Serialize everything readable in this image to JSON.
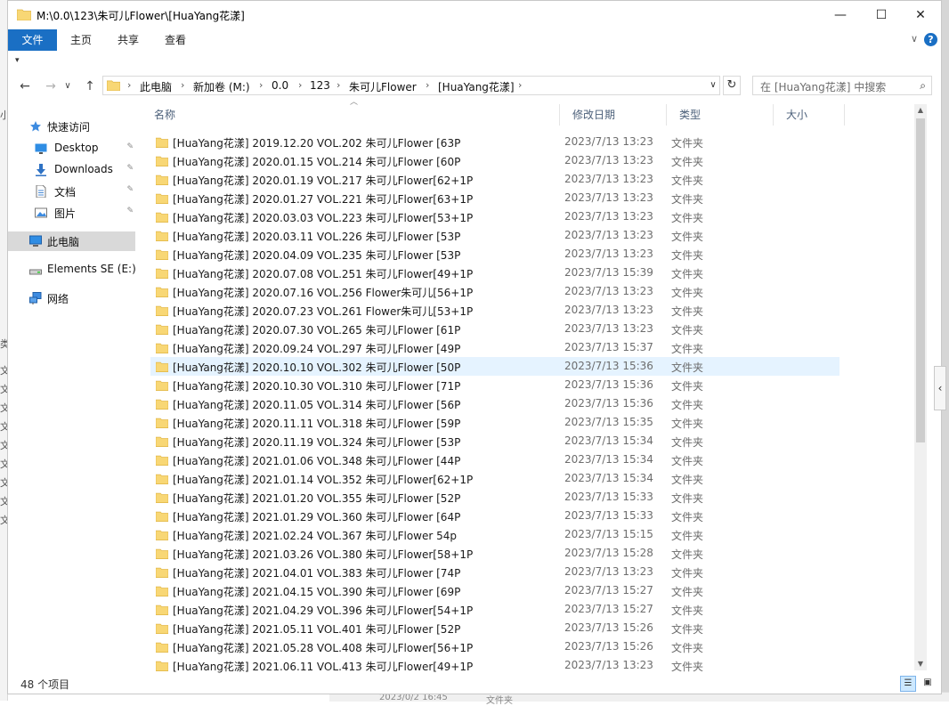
{
  "window": {
    "title": "M:\\0.0\\123\\朱可儿Flower\\[HuaYang花漾]",
    "minimize_glyph": "—",
    "maximize_glyph": "☐",
    "close_glyph": "✕"
  },
  "ribbon": {
    "tabs": [
      "文件",
      "主页",
      "共享",
      "查看"
    ],
    "expand_glyph": "∨",
    "help_glyph": "?"
  },
  "quick_access_glyph": "▾",
  "nav_buttons": {
    "back": "←",
    "forward": "→",
    "recent": "∨",
    "up": "↑"
  },
  "address": {
    "crumbs": [
      "此电脑",
      "新加卷 (M:)",
      "0.0",
      "123",
      "朱可儿Flower",
      "[HuaYang花漾]"
    ],
    "separator": "›",
    "dropdown_glyph": "∨",
    "refresh_glyph": "↻"
  },
  "search": {
    "placeholder": "在 [HuaYang花漾] 中搜索",
    "icon_glyph": "⌕"
  },
  "nav_pane": {
    "items": [
      {
        "label": "快速访问",
        "icon": "star-icon",
        "pinned": false
      },
      {
        "label": "Desktop",
        "icon": "desktop-icon",
        "pinned": true
      },
      {
        "label": "Downloads",
        "icon": "download-icon",
        "pinned": true
      },
      {
        "label": "文档",
        "icon": "document-icon",
        "pinned": true
      },
      {
        "label": "图片",
        "icon": "pictures-icon",
        "pinned": true
      },
      {
        "label": "此电脑",
        "icon": "computer-icon",
        "pinned": false
      },
      {
        "label": "Elements SE (E:)",
        "icon": "drive-icon",
        "pinned": false
      },
      {
        "label": "网络",
        "icon": "network-icon",
        "pinned": false
      }
    ],
    "pin_glyph": "✎"
  },
  "columns": [
    "名称",
    "修改日期",
    "类型",
    "大小"
  ],
  "sort_glyph": "︿",
  "files": [
    {
      "name": "[HuaYang花漾] 2019.12.20 VOL.202 朱可儿Flower [63P",
      "date": "2023/7/13 13:23",
      "type": "文件夹"
    },
    {
      "name": "[HuaYang花漾] 2020.01.15 VOL.214 朱可儿Flower [60P",
      "date": "2023/7/13 13:23",
      "type": "文件夹"
    },
    {
      "name": "[HuaYang花漾] 2020.01.19 VOL.217 朱可儿Flower[62+1P",
      "date": "2023/7/13 13:23",
      "type": "文件夹"
    },
    {
      "name": "[HuaYang花漾] 2020.01.27 VOL.221 朱可儿Flower[63+1P",
      "date": "2023/7/13 13:23",
      "type": "文件夹"
    },
    {
      "name": "[HuaYang花漾] 2020.03.03 VOL.223 朱可儿Flower[53+1P",
      "date": "2023/7/13 13:23",
      "type": "文件夹"
    },
    {
      "name": "[HuaYang花漾] 2020.03.11 VOL.226 朱可儿Flower [53P",
      "date": "2023/7/13 13:23",
      "type": "文件夹"
    },
    {
      "name": "[HuaYang花漾] 2020.04.09 VOL.235 朱可儿Flower [53P",
      "date": "2023/7/13 13:23",
      "type": "文件夹"
    },
    {
      "name": "[HuaYang花漾] 2020.07.08 VOL.251 朱可儿Flower[49+1P",
      "date": "2023/7/13 15:39",
      "type": "文件夹"
    },
    {
      "name": "[HuaYang花漾] 2020.07.16 VOL.256 Flower朱可儿[56+1P",
      "date": "2023/7/13 13:23",
      "type": "文件夹"
    },
    {
      "name": "[HuaYang花漾] 2020.07.23 VOL.261 Flower朱可儿[53+1P",
      "date": "2023/7/13 13:23",
      "type": "文件夹"
    },
    {
      "name": "[HuaYang花漾] 2020.07.30 VOL.265 朱可儿Flower [61P",
      "date": "2023/7/13 13:23",
      "type": "文件夹"
    },
    {
      "name": "[HuaYang花漾] 2020.09.24 VOL.297 朱可儿Flower [49P",
      "date": "2023/7/13 15:37",
      "type": "文件夹"
    },
    {
      "name": "[HuaYang花漾] 2020.10.10 VOL.302 朱可儿Flower [50P",
      "date": "2023/7/13 15:36",
      "type": "文件夹"
    },
    {
      "name": "[HuaYang花漾] 2020.10.30 VOL.310 朱可儿Flower [71P",
      "date": "2023/7/13 15:36",
      "type": "文件夹"
    },
    {
      "name": "[HuaYang花漾] 2020.11.05 VOL.314 朱可儿Flower [56P",
      "date": "2023/7/13 15:36",
      "type": "文件夹"
    },
    {
      "name": "[HuaYang花漾] 2020.11.11 VOL.318 朱可儿Flower [59P",
      "date": "2023/7/13 15:35",
      "type": "文件夹"
    },
    {
      "name": "[HuaYang花漾] 2020.11.19 VOL.324 朱可儿Flower [53P",
      "date": "2023/7/13 15:34",
      "type": "文件夹"
    },
    {
      "name": "[HuaYang花漾] 2021.01.06 VOL.348 朱可儿Flower [44P",
      "date": "2023/7/13 15:34",
      "type": "文件夹"
    },
    {
      "name": "[HuaYang花漾] 2021.01.14 VOL.352 朱可儿Flower[62+1P",
      "date": "2023/7/13 15:34",
      "type": "文件夹"
    },
    {
      "name": "[HuaYang花漾] 2021.01.20 VOL.355 朱可儿Flower [52P",
      "date": "2023/7/13 15:33",
      "type": "文件夹"
    },
    {
      "name": "[HuaYang花漾] 2021.01.29 VOL.360 朱可儿Flower [64P",
      "date": "2023/7/13 15:33",
      "type": "文件夹"
    },
    {
      "name": "[HuaYang花漾] 2021.02.24 VOL.367 朱可儿Flower 54p",
      "date": "2023/7/13 15:15",
      "type": "文件夹"
    },
    {
      "name": "[HuaYang花漾] 2021.03.26 VOL.380 朱可儿Flower[58+1P",
      "date": "2023/7/13 15:28",
      "type": "文件夹"
    },
    {
      "name": "[HuaYang花漾] 2021.04.01 VOL.383 朱可儿Flower [74P",
      "date": "2023/7/13 13:23",
      "type": "文件夹"
    },
    {
      "name": "[HuaYang花漾] 2021.04.15 VOL.390 朱可儿Flower [69P",
      "date": "2023/7/13 15:27",
      "type": "文件夹"
    },
    {
      "name": "[HuaYang花漾] 2021.04.29 VOL.396 朱可儿Flower[54+1P",
      "date": "2023/7/13 15:27",
      "type": "文件夹"
    },
    {
      "name": "[HuaYang花漾] 2021.05.11 VOL.401 朱可儿Flower [52P",
      "date": "2023/7/13 15:26",
      "type": "文件夹"
    },
    {
      "name": "[HuaYang花漾] 2021.05.28 VOL.408 朱可儿Flower[56+1P",
      "date": "2023/7/13 15:26",
      "type": "文件夹"
    },
    {
      "name": "[HuaYang花漾] 2021.06.11 VOL.413 朱可儿Flower[49+1P",
      "date": "2023/7/13 13:23",
      "type": "文件夹"
    }
  ],
  "hovered_row": 12,
  "scrollbar": {
    "up_glyph": "▲",
    "down_glyph": "▼"
  },
  "side_toggle_glyph": "‹",
  "status": {
    "count": "48 个项目",
    "details_view_glyph": "☰",
    "tiles_view_glyph": "▣"
  },
  "background_fragments": {
    "left_chars": [
      "小",
      "类",
      "文",
      "文",
      "文",
      "文",
      "文",
      "文",
      "文",
      "文",
      "文"
    ],
    "bottom_date": "2023/0/2 16:45",
    "bottom_type": "文件夹"
  },
  "colors": {
    "accent": "#1a6fc4",
    "folder": "#f8d775",
    "folder_edge": "#e0b545",
    "hover": "#e5f3ff",
    "selected": "#d9d9d9",
    "header_text": "#4c607a",
    "meta_text": "#6d6d6d"
  }
}
